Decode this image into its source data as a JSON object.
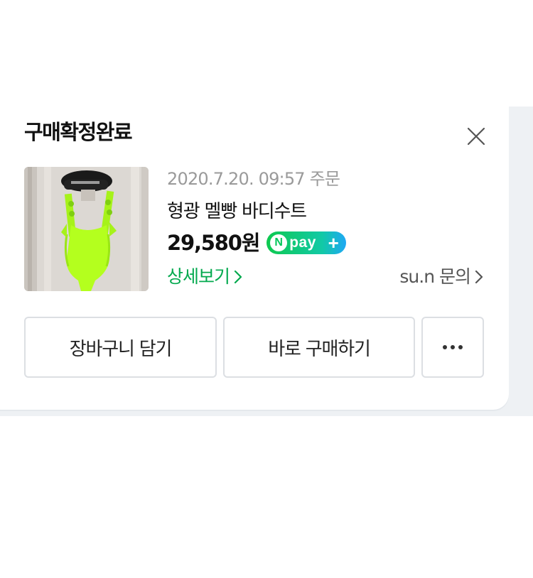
{
  "card": {
    "status_title": "구매확정완료",
    "order": {
      "date_text": "2020.7.20. 09:57 주문",
      "product_name": "형광 멜빵 바디수트",
      "price": "29,580원",
      "npay": {
        "n_letter": "N",
        "label": "pay",
        "plus": "+",
        "colors": [
          "#0ec94f",
          "#12c9a6",
          "#1ea8f5"
        ]
      },
      "detail_link": "상세보기",
      "inquiry_link": "su.n 문의",
      "thumbnail_icon": "bodysuit-product-photo"
    },
    "buttons": {
      "add_to_cart": "장바구니 담기",
      "buy_again": "바로 구매하기",
      "more_icon": "more-dots-icon"
    }
  },
  "colors": {
    "accent_green": "#03a94e",
    "text_primary": "#111111",
    "text_muted": "#9a9a9a",
    "border": "#dcdfe3"
  }
}
